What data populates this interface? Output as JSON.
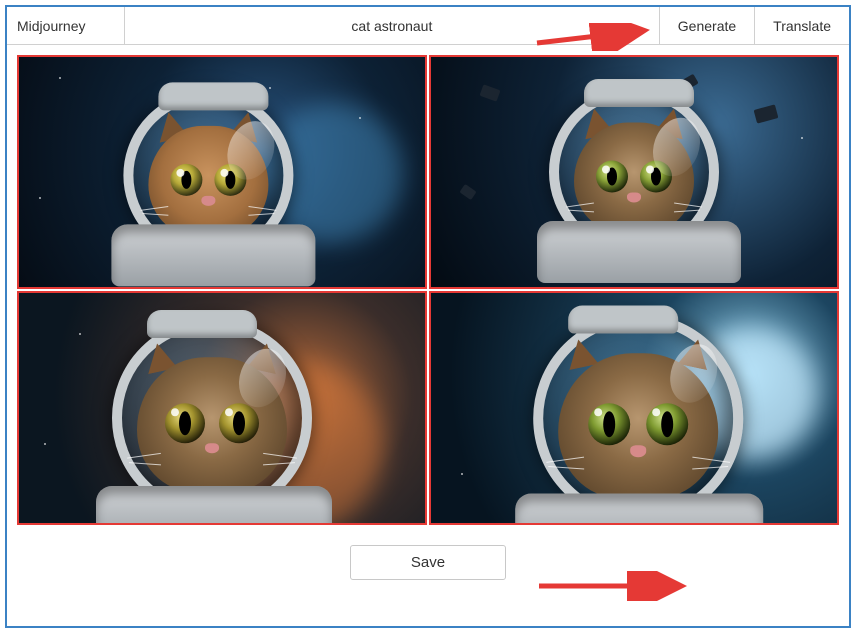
{
  "toolbar": {
    "model_label": "Midjourney",
    "prompt_value": "cat astronaut",
    "generate_label": "Generate",
    "translate_label": "Translate"
  },
  "actions": {
    "save_label": "Save"
  },
  "images": {
    "count": 4,
    "subject": "cat astronaut"
  }
}
